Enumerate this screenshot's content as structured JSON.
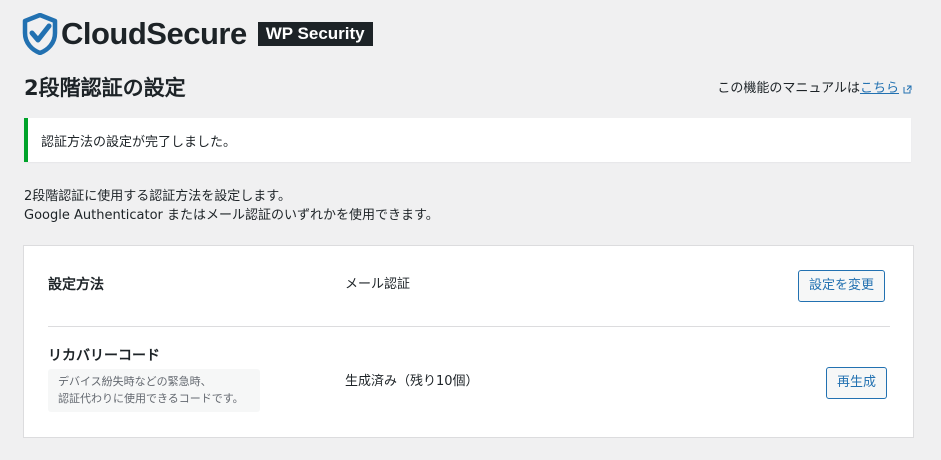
{
  "brand": {
    "name": "CloudSecure",
    "badge": "WP Security",
    "shield_color": "#2271b1"
  },
  "page": {
    "title": "2段階認証の設定",
    "manual_prefix": "この機能のマニュアルは",
    "manual_link": "こちら"
  },
  "notice": {
    "text": "認証方法の設定が完了しました。",
    "color": "#00a32a"
  },
  "description": {
    "line1": "2段階認証に使用する認証方法を設定します。",
    "line2": "Google Authenticator またはメール認証のいずれかを使用できます。"
  },
  "settings": {
    "method": {
      "label": "設定方法",
      "value": "メール認証",
      "button": "設定を変更"
    },
    "recovery": {
      "label": "リカバリーコード",
      "hint_line1": "デバイス紛失時などの緊急時、",
      "hint_line2": "認証代わりに使用できるコードです。",
      "value": "生成済み（残り10個）",
      "button": "再生成"
    }
  },
  "colors": {
    "accent": "#2271b1",
    "background": "#f0f0f1",
    "text": "#1d2327"
  }
}
